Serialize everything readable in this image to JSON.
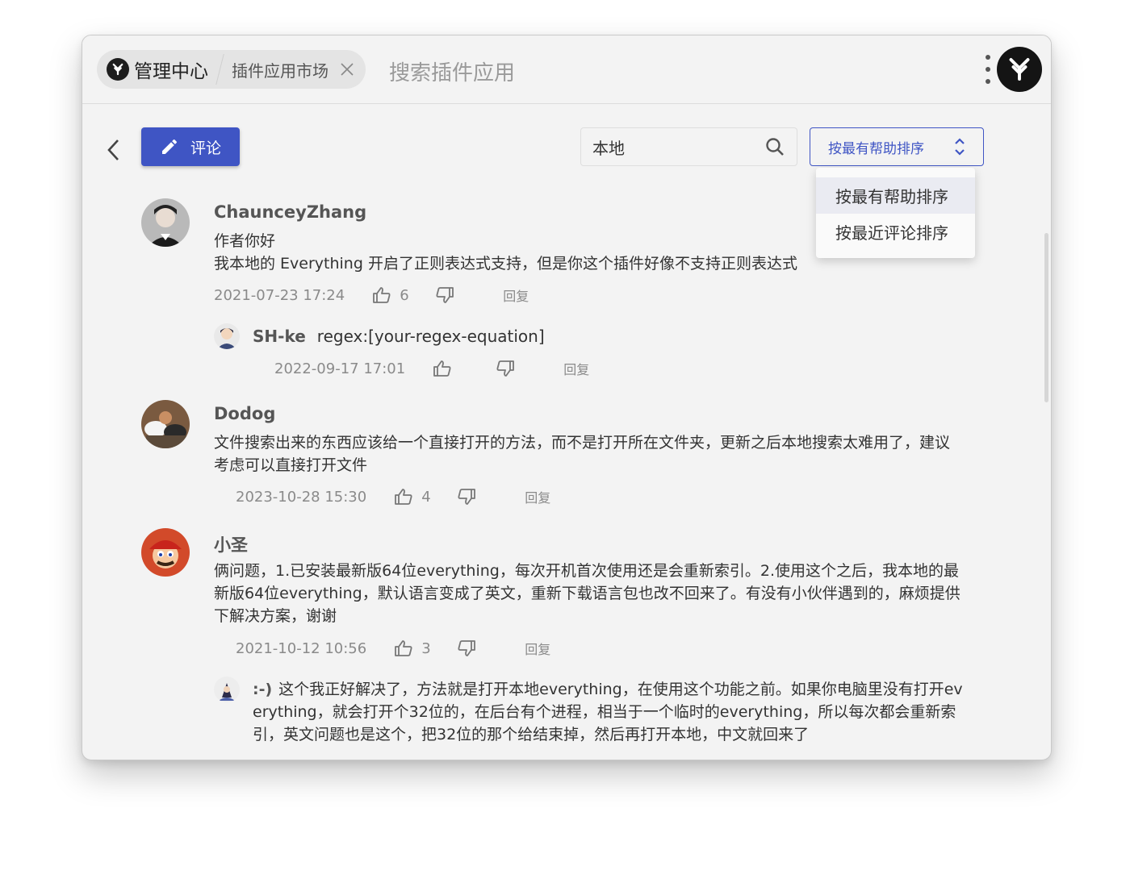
{
  "header": {
    "home_label": "管理中心",
    "tab_label": "插件应用市场",
    "search_title": "搜索插件应用"
  },
  "toolbar": {
    "comment_label": "评论",
    "search_value": "本地",
    "sort_label": "按最有帮助排序"
  },
  "sort_menu": {
    "options": [
      "按最有帮助排序",
      "按最近评论排序"
    ]
  },
  "comments": [
    {
      "author": "ChaunceyZhang",
      "lines": [
        "作者你好",
        "我本地的 Everything 开启了正则表达式支持，但是你这个插件好像不支持正则表达式"
      ],
      "date": "2021-07-23 17:24",
      "likes": "6",
      "reply_label": "回复",
      "replies": [
        {
          "author": "SH-ke",
          "text": "regex:[your-regex-equation]",
          "date": "2022-09-17 17:01",
          "likes": "",
          "reply_label": "回复"
        }
      ]
    },
    {
      "author": "Dodog",
      "lines": [
        "文件搜索出来的东西应该给一个直接打开的方法，而不是打开所在文件夹，更新之后本地搜索太难用了，建议",
        "考虑可以直接打开文件"
      ],
      "date": "2023-10-28 15:30",
      "likes": "4",
      "reply_label": "回复"
    },
    {
      "author": "小圣",
      "lines": [
        "俩问题，1.已安装最新版64位everything，每次开机首次使用还是会重新索引。2.使用这个之后，我本地的最",
        "新版64位everything，默认语言变成了英文，重新下载语言包也改不回来了。有没有小伙伴遇到的，麻烦提供",
        "下解决方案，谢谢"
      ],
      "date": "2021-10-12 10:56",
      "likes": "3",
      "reply_label": "回复",
      "replies": [
        {
          "author": ":-)",
          "lines": [
            "这个我正好解决了，方法就是打开本地everything，在使用这个功能之前。如果你电脑里没有打开ev",
            "erything，就会打开个32位的，在后台有个进程，相当于一个临时的everything，所以每次都会重新索",
            "引，英文问题也是这个，把32位的那个给结束掉，然后再打开本地，中文就回来了"
          ]
        }
      ]
    }
  ],
  "colors": {
    "accent": "#3f55c4",
    "background": "#f3f3f3"
  }
}
